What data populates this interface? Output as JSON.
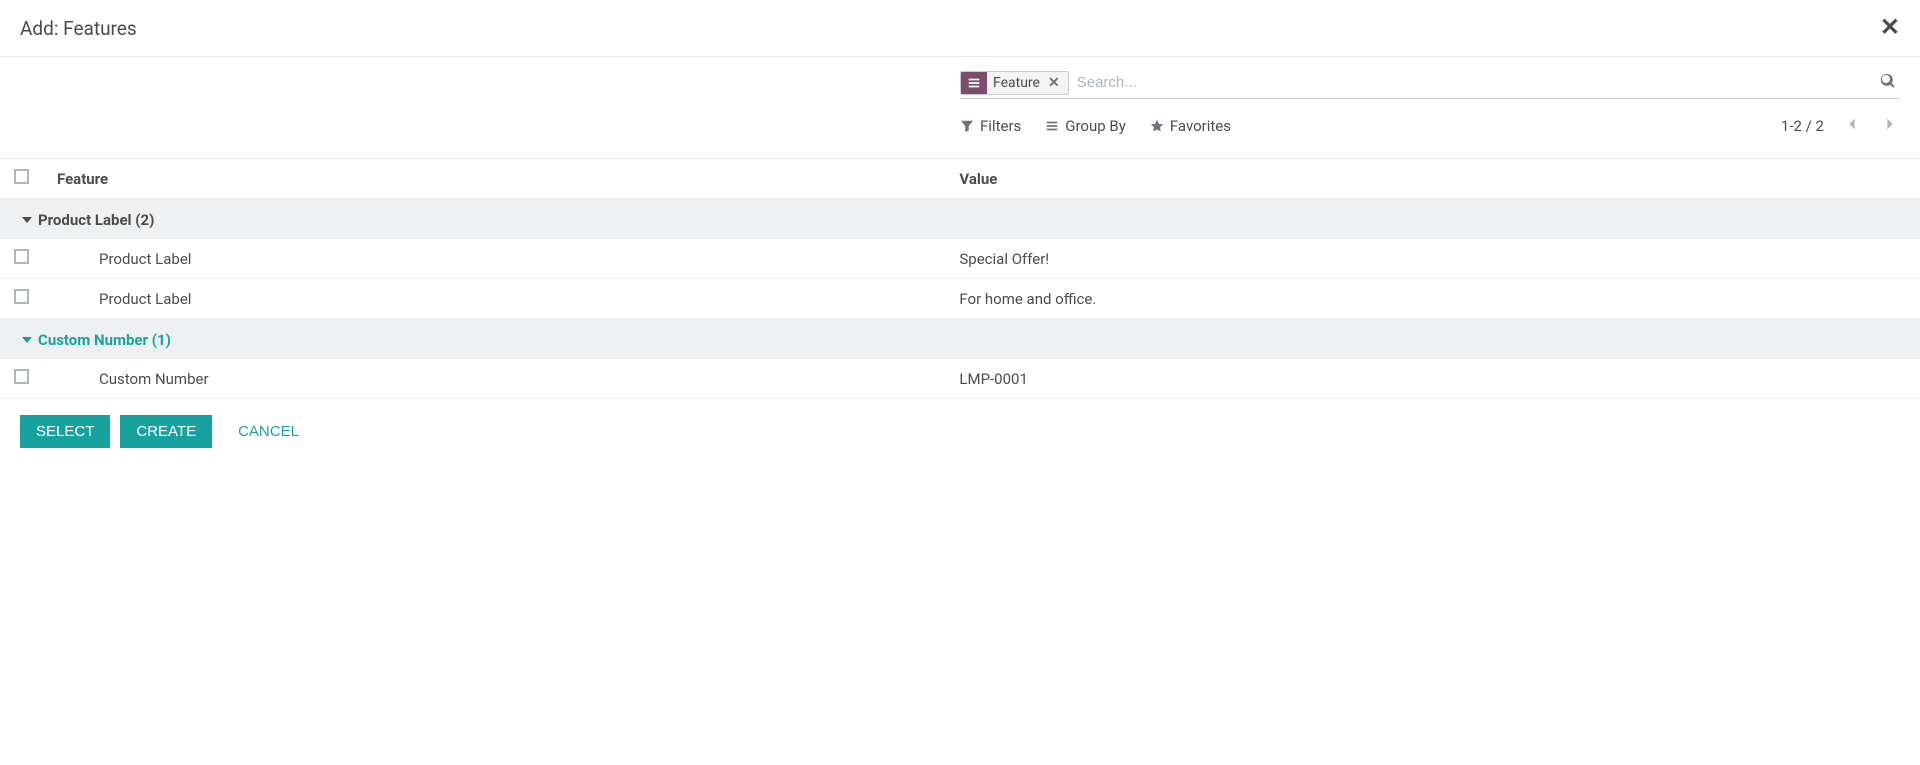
{
  "modal": {
    "title": "Add: Features",
    "close_aria": "Close"
  },
  "search": {
    "group_chip_label": "Feature",
    "placeholder": "Search..."
  },
  "toolbar": {
    "filters_label": "Filters",
    "groupby_label": "Group By",
    "favorites_label": "Favorites",
    "pager_text": "1-2 / 2"
  },
  "table": {
    "columns": {
      "feature": "Feature",
      "value": "Value"
    },
    "groups": [
      {
        "label": "Product Label (2)",
        "highlighted": false,
        "rows": [
          {
            "feature": "Product Label",
            "value": "Special Offer!"
          },
          {
            "feature": "Product Label",
            "value": "For home and office."
          }
        ]
      },
      {
        "label": "Custom Number (1)",
        "highlighted": true,
        "rows": [
          {
            "feature": "Custom Number",
            "value": "LMP-0001"
          }
        ]
      }
    ]
  },
  "footer": {
    "select_label": "SELECT",
    "create_label": "CREATE",
    "cancel_label": "CANCEL"
  }
}
